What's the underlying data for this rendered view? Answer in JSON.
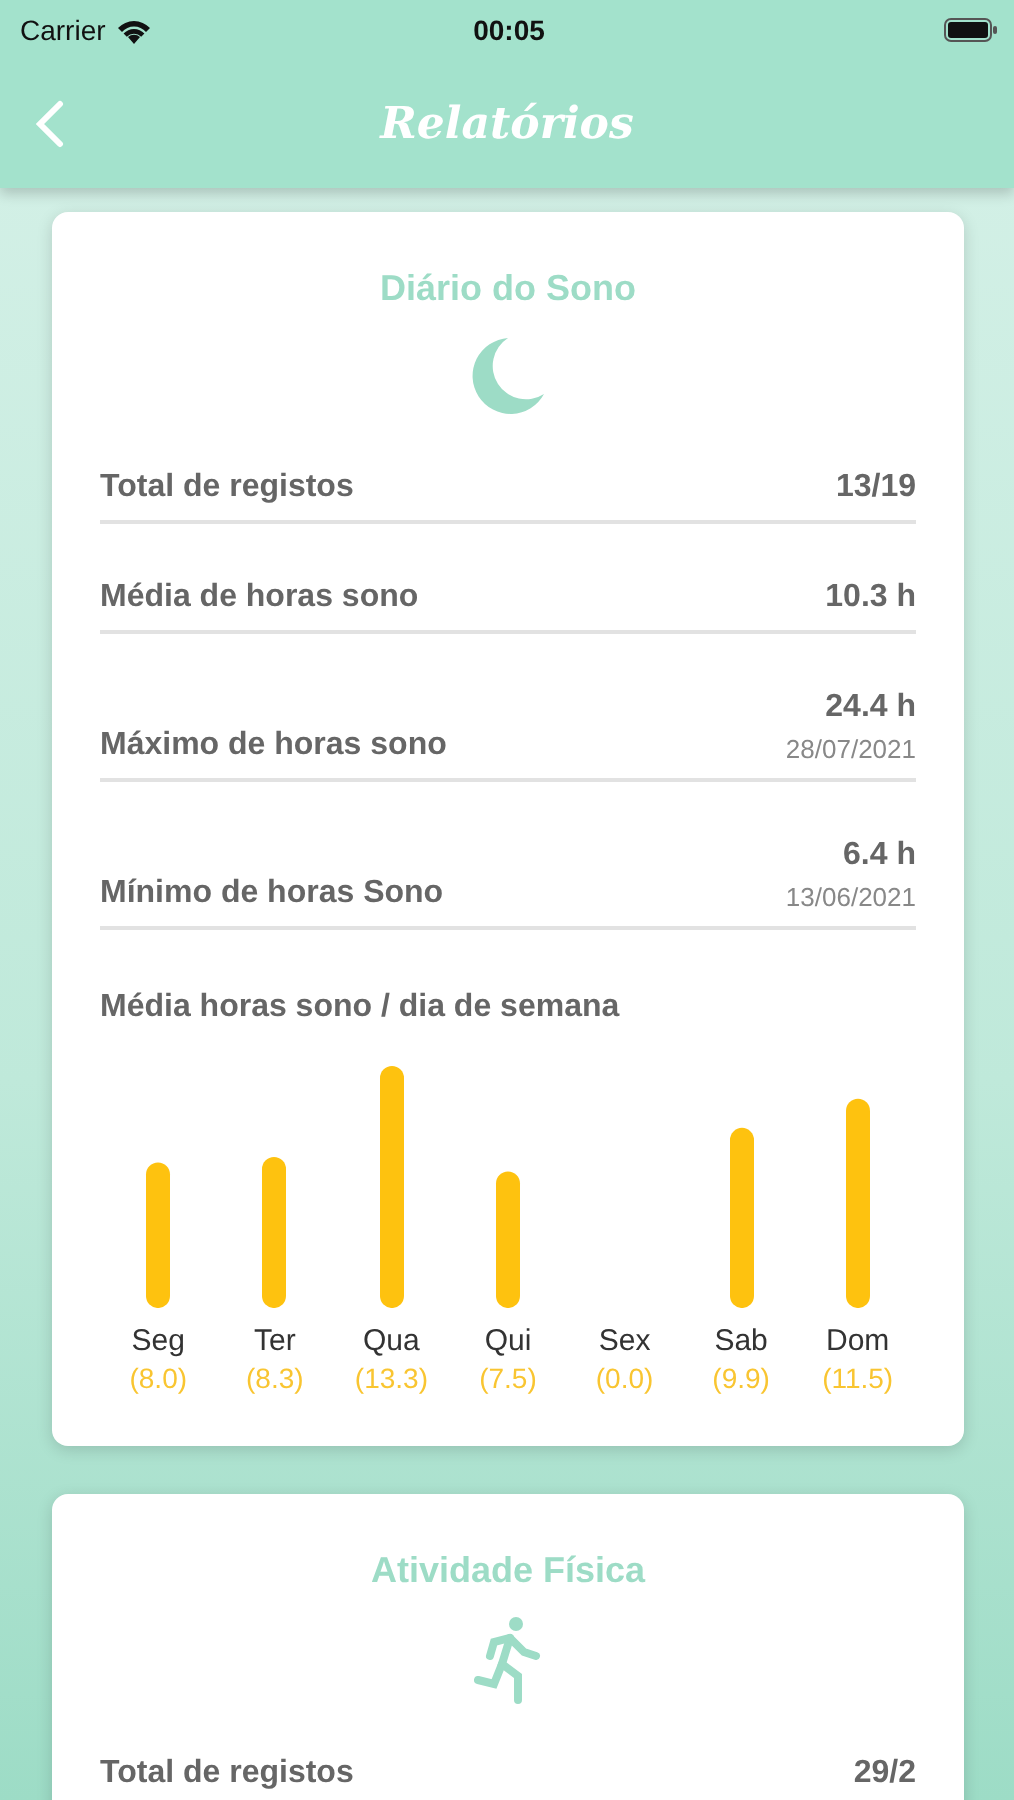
{
  "status_bar": {
    "carrier": "Carrier",
    "time": "00:05"
  },
  "nav": {
    "title": "Relatórios"
  },
  "cards": [
    {
      "title": "Diário do Sono",
      "kind": "sleep",
      "stats": [
        {
          "label": "Total de registos",
          "value": "13/19"
        },
        {
          "label": "Média de horas sono",
          "value": "10.3 h"
        },
        {
          "label": "Máximo de horas sono",
          "value": "24.4 h",
          "date": "28/07/2021"
        },
        {
          "label": "Mínimo de horas Sono",
          "value": "6.4 h",
          "date": "13/06/2021"
        }
      ],
      "chart_data": {
        "type": "bar",
        "title": "Média horas sono / dia de semana",
        "categories": [
          "Seg",
          "Ter",
          "Qua",
          "Qui",
          "Sex",
          "Sab",
          "Dom"
        ],
        "values": [
          8.0,
          8.3,
          13.3,
          7.5,
          0.0,
          9.9,
          11.5
        ],
        "value_labels": [
          "(8.0)",
          "(8.3)",
          "(13.3)",
          "(7.5)",
          "(0.0)",
          "(9.9)",
          "(11.5)"
        ]
      }
    },
    {
      "title": "Atividade Física",
      "kind": "activity",
      "stats": [
        {
          "label": "Total de registos",
          "value": "29/2"
        }
      ]
    }
  ]
}
